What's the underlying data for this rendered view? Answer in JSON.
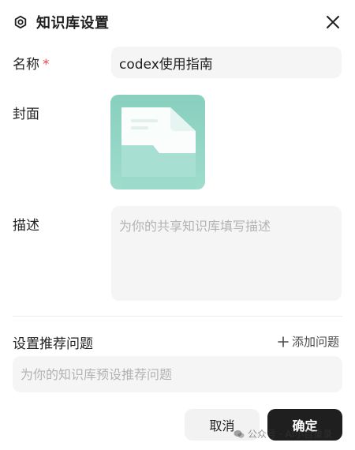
{
  "dialog": {
    "title": "知识库设置",
    "close_icon": "close-icon"
  },
  "form": {
    "name": {
      "label": "名称",
      "required_mark": "*",
      "value": "codex使用指南"
    },
    "cover": {
      "label": "封面",
      "image": "document-folder-illustration"
    },
    "description": {
      "label": "描述",
      "value": "",
      "placeholder": "为你的共享知识库填写描述"
    },
    "questions": {
      "label": "设置推荐问题",
      "add_label": "添加问题",
      "value": "",
      "placeholder": "为你的知识库预设推荐问题"
    }
  },
  "actions": {
    "cancel_label": "取消",
    "confirm_label": "确定"
  },
  "watermark": {
    "text": "公众号 · AI小百重录"
  },
  "colors": {
    "primary_button": "#1f1f1f",
    "required": "#e5484d",
    "cover_bg": "#88cfbe",
    "input_bg": "#f5f5f5"
  }
}
